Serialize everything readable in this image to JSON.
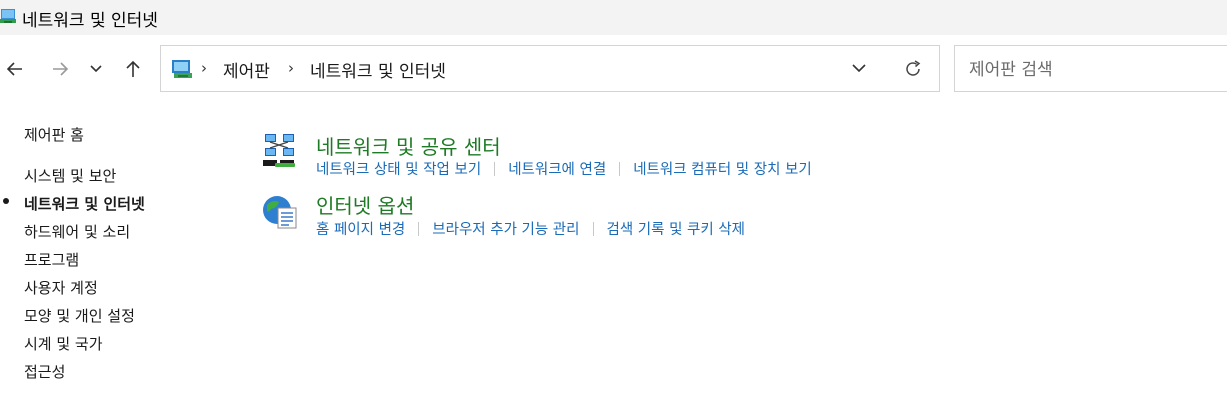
{
  "window": {
    "title": "네트워크 및 인터넷"
  },
  "address": {
    "crumbs": [
      "제어판",
      "네트워크 및 인터넷"
    ]
  },
  "search": {
    "placeholder": "제어판 검색"
  },
  "sidebar": {
    "home": "제어판 홈",
    "items": [
      {
        "label": "시스템 및 보안",
        "active": false
      },
      {
        "label": "네트워크 및 인터넷",
        "active": true
      },
      {
        "label": "하드웨어 및 소리",
        "active": false
      },
      {
        "label": "프로그램",
        "active": false
      },
      {
        "label": "사용자 계정",
        "active": false
      },
      {
        "label": "모양 및 개인 설정",
        "active": false
      },
      {
        "label": "시계 및 국가",
        "active": false
      },
      {
        "label": "접근성",
        "active": false
      }
    ]
  },
  "categories": [
    {
      "title": "네트워크 및 공유 센터",
      "icon": "network-sharing-center-icon",
      "links": [
        "네트워크 상태 및 작업 보기",
        "네트워크에 연결",
        "네트워크 컴퓨터 및 장치 보기"
      ]
    },
    {
      "title": "인터넷 옵션",
      "icon": "internet-options-icon",
      "links": [
        "홈 페이지 변경",
        "브라우저 추가 기능 관리",
        "검색 기록 및 쿠키 삭제"
      ]
    }
  ],
  "colors": {
    "category_title": "#1e7a25",
    "link": "#1a6bb8",
    "titlebar_bg": "#f3f3f3"
  }
}
